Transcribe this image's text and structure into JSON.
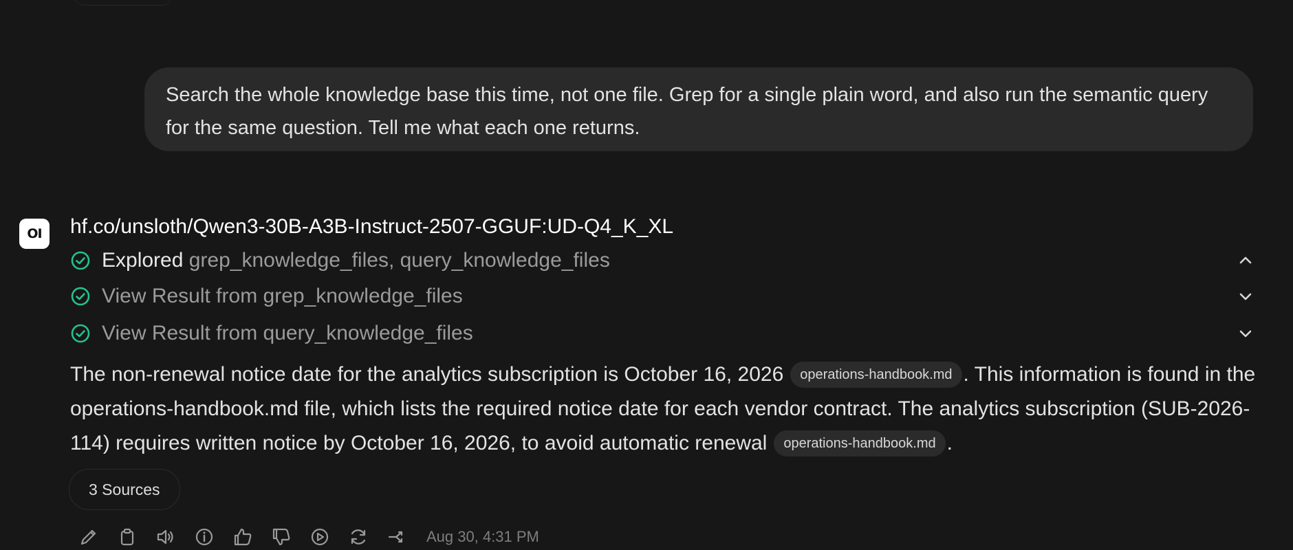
{
  "user_message": "Search the whole knowledge base this time, not one file. Grep for a single plain word, and also run the semantic query for the same question. Tell me what each one returns.",
  "assistant": {
    "avatar_label": "OI",
    "model_name": "hf.co/unsloth/Qwen3-30B-A3B-Instruct-2507-GGUF:UD-Q4_K_XL",
    "tool_steps": [
      {
        "prefix": "Explored",
        "label": "grep_knowledge_files, query_knowledge_files",
        "chevron": "chevron-up-icon"
      },
      {
        "prefix": "",
        "label": "View Result from grep_knowledge_files",
        "chevron": "chevron-down-icon"
      },
      {
        "prefix": "",
        "label": "View Result from query_knowledge_files",
        "chevron": "chevron-down-icon"
      }
    ],
    "answer": {
      "part1": "The non-renewal notice date for the analytics subscription is October 16, 2026",
      "citation1": "operations-handbook.md",
      "part2": ". This information is found in the operations-handbook.md file, which lists the required notice date for each vendor contract. The analytics subscription (SUB-2026-114) requires written notice by October 16, 2026, to avoid automatic renewal",
      "citation2": "operations-handbook.md",
      "part3": "."
    },
    "sources_label": "3 Sources",
    "actions": [
      "edit-icon",
      "copy-icon",
      "read-aloud-icon",
      "info-icon",
      "thumbs-up-icon",
      "thumbs-down-icon",
      "continue-icon",
      "regenerate-icon",
      "branch-icon"
    ],
    "timestamp": "Aug 30, 4:31 PM"
  },
  "colors": {
    "background": "#171717",
    "user_bubble": "#2a2a2a",
    "check_green": "#22c58b",
    "muted_text": "#9b9b9b"
  }
}
